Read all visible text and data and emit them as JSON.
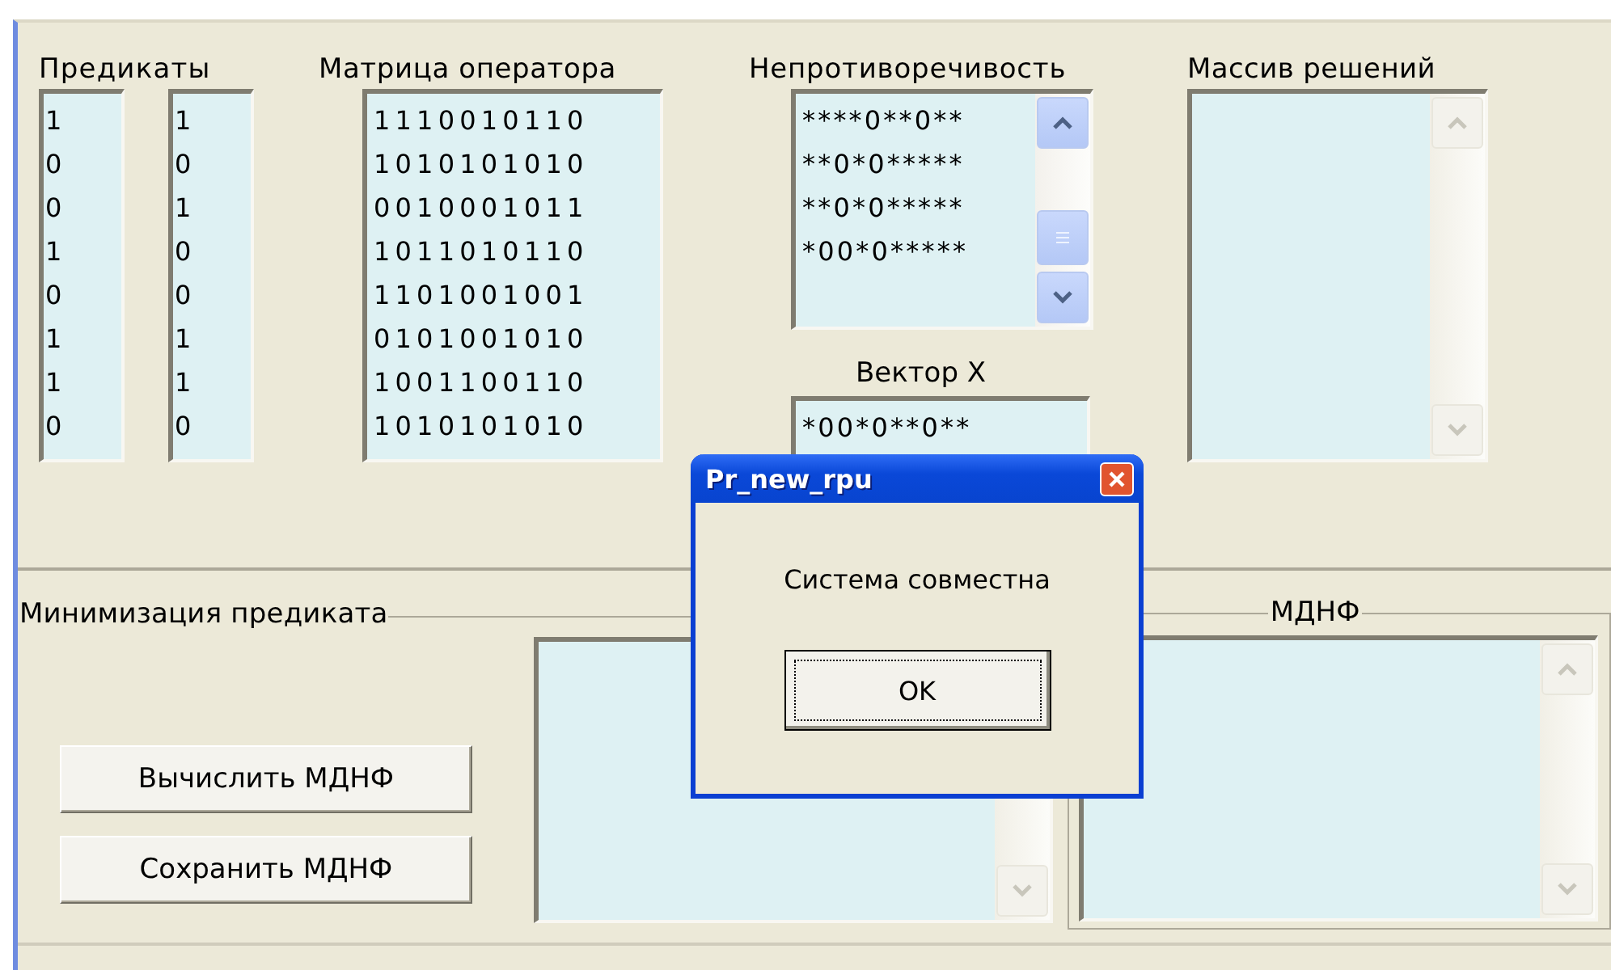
{
  "predicates": {
    "label": "Предикаты",
    "column_1": [
      "1",
      "0",
      "0",
      "1",
      "0",
      "1",
      "1",
      "0"
    ],
    "column_2": [
      "1",
      "0",
      "1",
      "0",
      "0",
      "1",
      "1",
      "0"
    ]
  },
  "matrix": {
    "label": "Матрица оператора",
    "rows": [
      "1110010110",
      "1010101010",
      "0010001011",
      "1011010110",
      "1101001001",
      "0101001010",
      "1001100110",
      "1010101010"
    ]
  },
  "consistency": {
    "label": "Непротиворечивость",
    "rows": [
      "****0**0**",
      "**0*0*****",
      "**0*0*****",
      "*00*0*****"
    ]
  },
  "vector_x": {
    "label": "Вектор X",
    "value": "*00*0**0**"
  },
  "solutions": {
    "label": "Массив решений"
  },
  "minimization": {
    "label": "Минимизация предиката",
    "buttons": [
      "Вычислить МДНФ",
      "Сохранить МДНФ"
    ]
  },
  "mdnf": {
    "label": "МДНФ"
  },
  "dialog": {
    "title": "Pr_new_rpu",
    "message": "Система совместна",
    "button": "OK"
  }
}
